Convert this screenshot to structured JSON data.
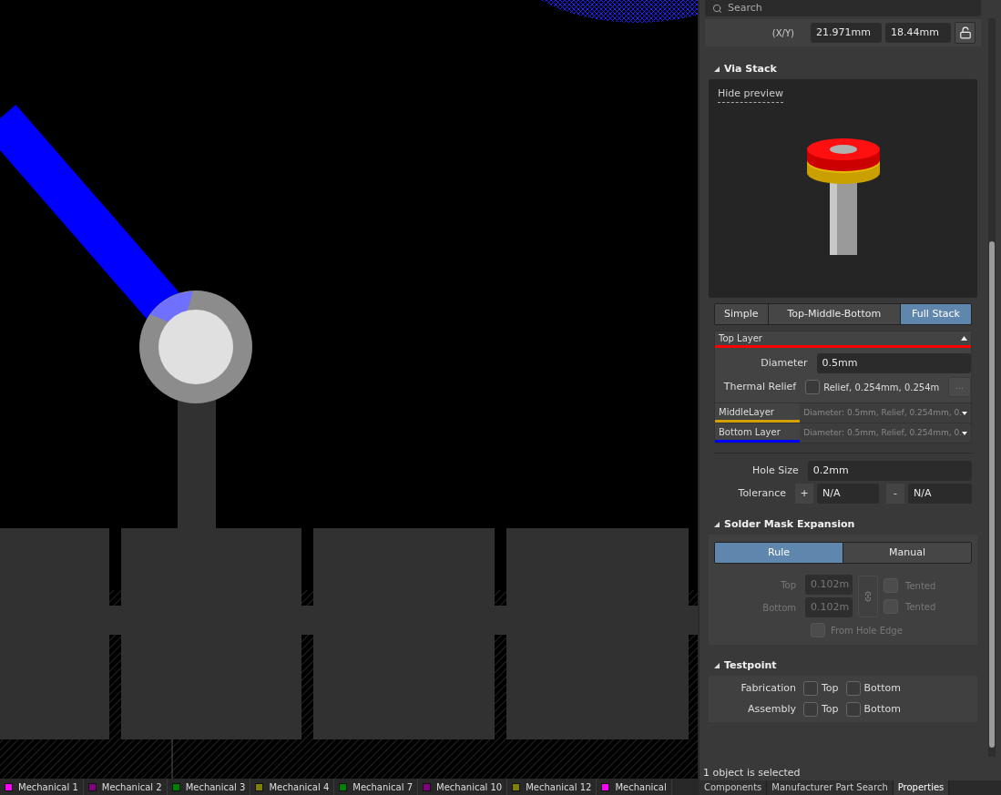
{
  "layer_tabs": [
    {
      "label": "Mechanical 1",
      "color": "#ff00ff"
    },
    {
      "label": "Mechanical 2",
      "color": "#800080"
    },
    {
      "label": "Mechanical 3",
      "color": "#008000"
    },
    {
      "label": "Mechanical 4",
      "color": "#808000"
    },
    {
      "label": "Mechanical 7",
      "color": "#008000"
    },
    {
      "label": "Mechanical 10",
      "color": "#800080"
    },
    {
      "label": "Mechanical 12",
      "color": "#808000"
    },
    {
      "label": "Mechanical",
      "color": "#ff00ff"
    }
  ],
  "panel": {
    "search": {
      "placeholder": "Search"
    },
    "location": {
      "label": "(X/Y)",
      "x": "21.971mm",
      "y": "18.44mm",
      "locked": false
    },
    "via_stack": {
      "title": "Via Stack",
      "expanded": true,
      "preview_link": "Hide preview",
      "modes": [
        {
          "label": "Simple",
          "selected": false
        },
        {
          "label": "Top-Middle-Bottom",
          "selected": false
        },
        {
          "label": "Full Stack",
          "selected": true
        }
      ],
      "top_layer": {
        "name": "Top Layer",
        "color": "#ff0000",
        "expanded": true,
        "diameter_label": "Diameter",
        "diameter": "0.5mm",
        "thermal_label": "Thermal Relief",
        "thermal_checked": false,
        "thermal_value": "Relief, 0.254mm, 0.254m",
        "more_button": "..."
      },
      "other_layers": [
        {
          "name": "MiddleLayer",
          "color": "#d4a000",
          "summary": "Diameter: 0.5mm, Relief, 0.254mm, 0."
        },
        {
          "name": "Bottom Layer",
          "color": "#0000ff",
          "summary": "Diameter: 0.5mm, Relief, 0.254mm, 0."
        }
      ],
      "hole_size_label": "Hole Size",
      "hole_size": "0.2mm",
      "tolerance_label": "Tolerance",
      "tol_plus": "+",
      "tol_plus_value": "N/A",
      "tol_minus": "-",
      "tol_minus_value": "N/A"
    },
    "solder_mask": {
      "title": "Solder Mask Expansion",
      "expanded": true,
      "disabled": true,
      "modes": [
        {
          "label": "Rule",
          "selected": true
        },
        {
          "label": "Manual",
          "selected": false
        }
      ],
      "rows": [
        {
          "label": "Top",
          "value": "0.102m",
          "tented_label": "Tented",
          "tented": false
        },
        {
          "label": "Bottom",
          "value": "0.102m",
          "tented_label": "Tented",
          "tented": false
        }
      ],
      "from_hole_edge": {
        "label": "From Hole Edge",
        "checked": false
      }
    },
    "testpoint": {
      "title": "Testpoint",
      "expanded": true,
      "rows": [
        {
          "label": "Fabrication",
          "options": [
            {
              "label": "Top",
              "checked": false
            },
            {
              "label": "Bottom",
              "checked": false
            }
          ]
        },
        {
          "label": "Assembly",
          "options": [
            {
              "label": "Top",
              "checked": false
            },
            {
              "label": "Bottom",
              "checked": false
            }
          ]
        }
      ]
    },
    "status": "1 object is selected",
    "tabs": [
      {
        "label": "Components",
        "selected": false
      },
      {
        "label": "Manufacturer Part Search",
        "selected": false
      },
      {
        "label": "Properties",
        "selected": true
      }
    ]
  }
}
